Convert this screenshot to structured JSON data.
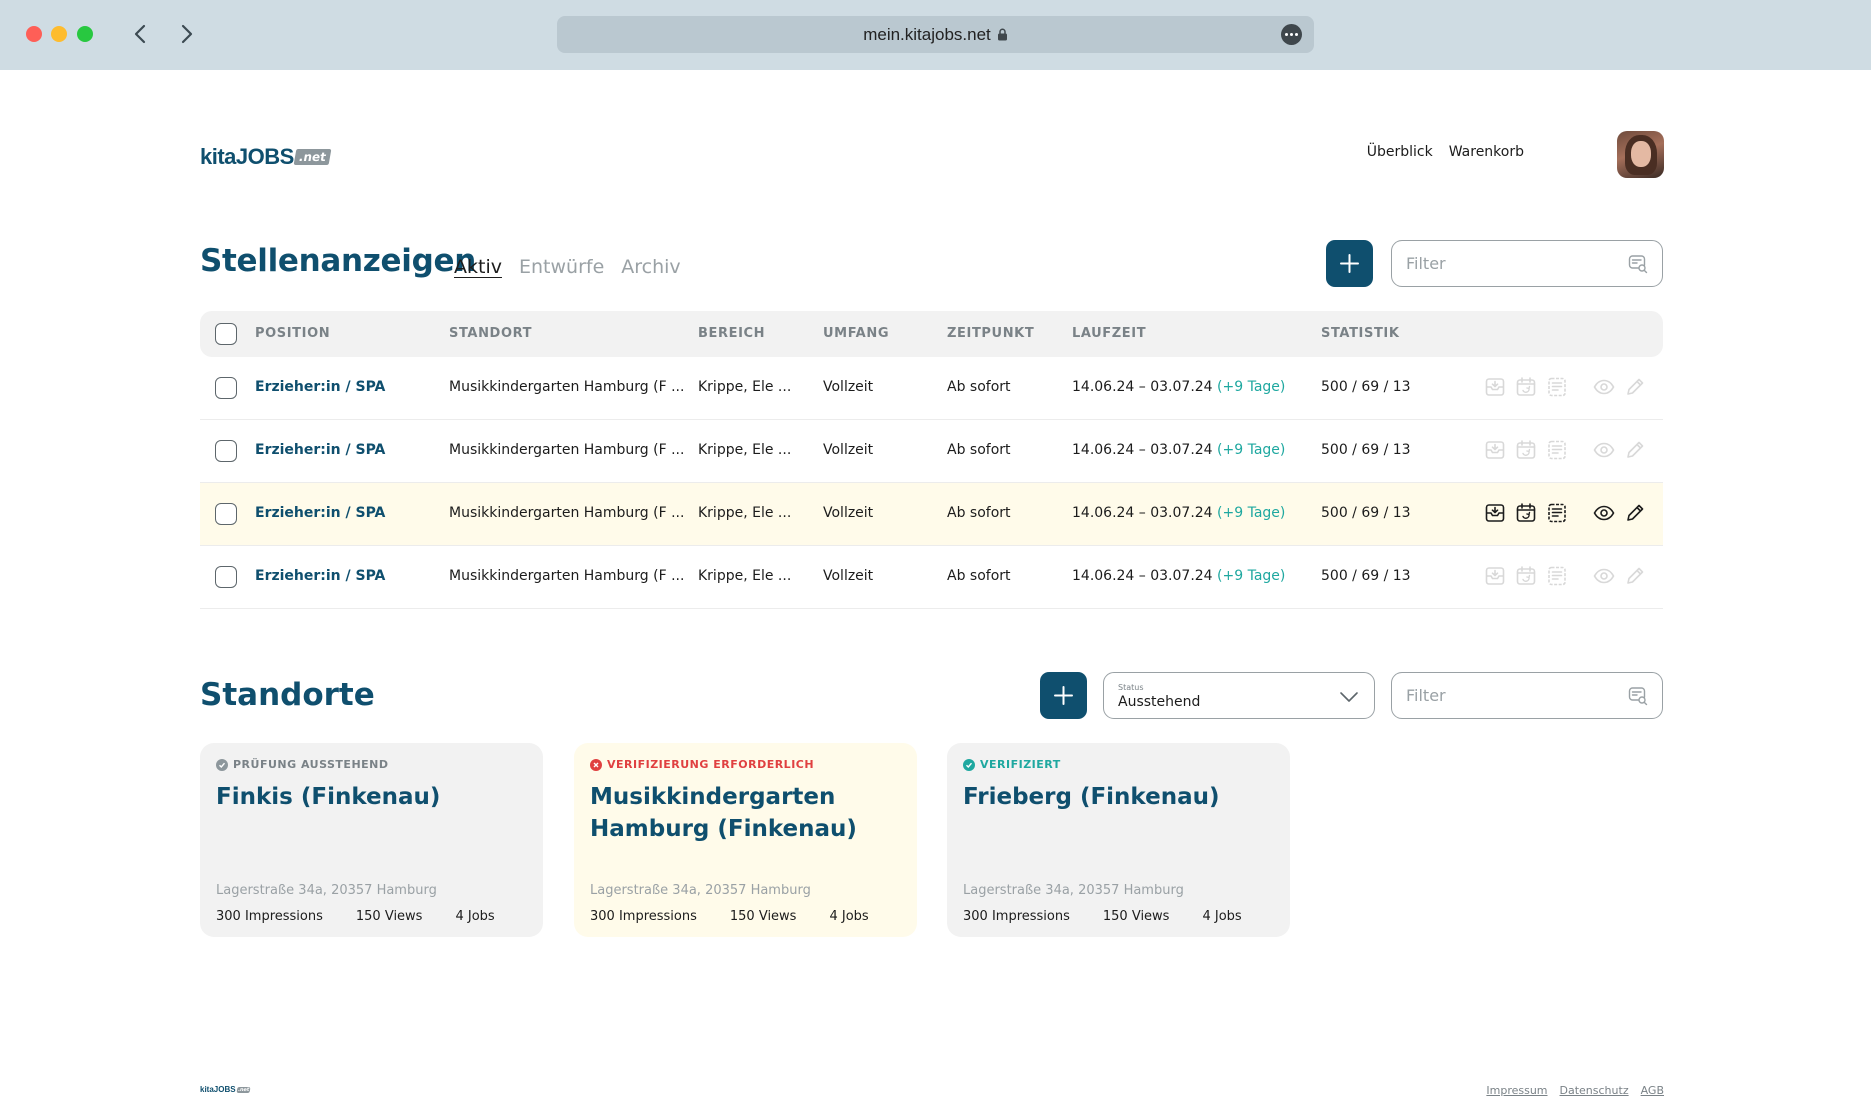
{
  "browser": {
    "url": "mein.kitajobs.net"
  },
  "header": {
    "logo_main": "kitaJOBS",
    "logo_suffix": ".net",
    "nav": [
      "Überblick",
      "Warenkorb"
    ]
  },
  "jobs": {
    "title": "Stellenanzeigen",
    "tabs": [
      {
        "label": "Aktiv",
        "active": true
      },
      {
        "label": "Entwürfe",
        "active": false
      },
      {
        "label": "Archiv",
        "active": false
      }
    ],
    "filter_placeholder": "Filter",
    "columns": [
      "POSITION",
      "STANDORT",
      "BEREICH",
      "UMFANG",
      "ZEITPUNKT",
      "LAUFZEIT",
      "STATISTIK"
    ],
    "rows": [
      {
        "position": "Erzieher:in / SPA",
        "standort": "Musikkindergarten Hamburg (F ...",
        "bereich": "Krippe, Ele ...",
        "umfang": "Vollzeit",
        "zeitpunkt": "Ab sofort",
        "laufzeit": "14.06.24 – 03.07.24",
        "extra": "(+9 Tage)",
        "statistik": "500 / 69 / 13",
        "highlighted": false
      },
      {
        "position": "Erzieher:in / SPA",
        "standort": "Musikkindergarten Hamburg (F ...",
        "bereich": "Krippe, Ele ...",
        "umfang": "Vollzeit",
        "zeitpunkt": "Ab sofort",
        "laufzeit": "14.06.24 – 03.07.24",
        "extra": "(+9 Tage)",
        "statistik": "500 / 69 / 13",
        "highlighted": false
      },
      {
        "position": "Erzieher:in / SPA",
        "standort": "Musikkindergarten Hamburg (F ...",
        "bereich": "Krippe, Ele ...",
        "umfang": "Vollzeit",
        "zeitpunkt": "Ab sofort",
        "laufzeit": "14.06.24 – 03.07.24",
        "extra": "(+9 Tage)",
        "statistik": "500 / 69 / 13",
        "highlighted": true
      },
      {
        "position": "Erzieher:in / SPA",
        "standort": "Musikkindergarten Hamburg (F ...",
        "bereich": "Krippe, Ele ...",
        "umfang": "Vollzeit",
        "zeitpunkt": "Ab sofort",
        "laufzeit": "14.06.24 – 03.07.24",
        "extra": "(+9 Tage)",
        "statistik": "500 / 69 / 13",
        "highlighted": false
      }
    ],
    "row_action_icons": [
      "download-icon",
      "calendar-renew-icon",
      "document-icon",
      "eye-icon",
      "pencil-icon"
    ]
  },
  "locations": {
    "title": "Standorte",
    "status_select": {
      "label": "Status",
      "value": "Ausstehend"
    },
    "filter_placeholder": "Filter",
    "cards": [
      {
        "status": "PRÜFUNG AUSSTEHEND",
        "status_color": "#8d979c",
        "name": "Finkis (Finkenau)",
        "address": "Lagerstraße 34a, 20357 Hamburg",
        "impressions": "300 Impressions",
        "views": "150 Views",
        "jobs": "4 Jobs"
      },
      {
        "status": "VERIFIZIERUNG ERFORDERLICH",
        "status_color": "#e04040",
        "name": "Musikkindergarten Hamburg (Finkenau)",
        "address": "Lagerstraße 34a, 20357 Hamburg",
        "impressions": "300 Impressions",
        "views": "150 Views",
        "jobs": "4 Jobs"
      },
      {
        "status": "VERIFIZIERT",
        "status_color": "#1fa8a0",
        "name": "Frieberg (Finkenau)",
        "address": "Lagerstraße 34a, 20357 Hamburg",
        "impressions": "300 Impressions",
        "views": "150 Views",
        "jobs": "4 Jobs"
      }
    ]
  },
  "footer": {
    "links": [
      "Impressum",
      "Datenschutz",
      "AGB"
    ]
  },
  "colors": {
    "brand": "#0f4f6e",
    "accent_teal": "#1fa8a0",
    "highlight_row": "#fffbea"
  }
}
